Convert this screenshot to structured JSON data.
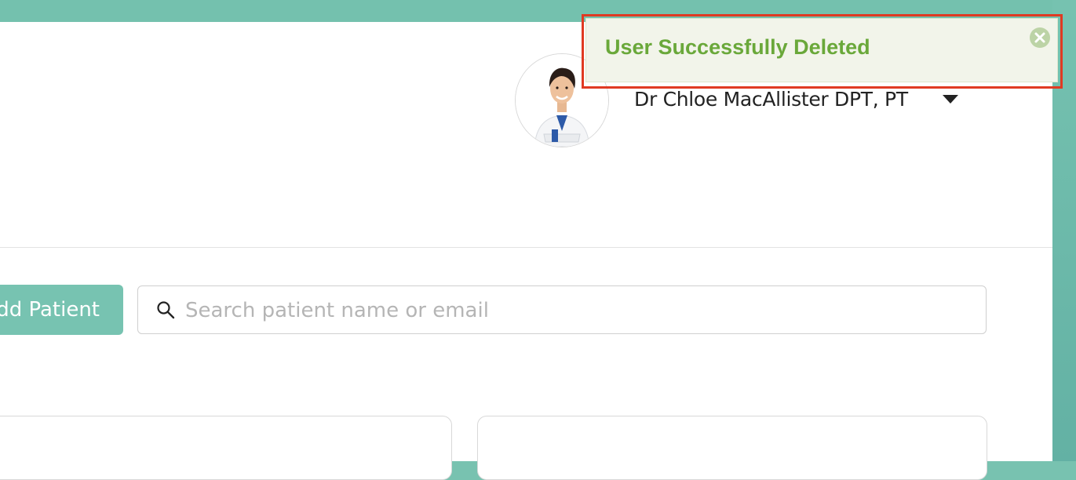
{
  "header": {
    "user_name": "Dr Chloe MacAllister DPT, PT",
    "avatar_alt": "Profile photo of Dr Chloe MacAllister"
  },
  "toolbar": {
    "add_patient_label": "dd Patient",
    "search_placeholder": "Search patient name or email",
    "search_value": ""
  },
  "toast": {
    "message": "User Successfully Deleted",
    "status": "success"
  },
  "icons": {
    "search": "search-icon",
    "close": "close-circle-icon",
    "dropdown": "caret-down-icon"
  },
  "colors": {
    "brand": "#74c1ae",
    "toast_text": "#6aa83a",
    "toast_bg": "#f2f4ea",
    "highlight": "#e03a22"
  }
}
